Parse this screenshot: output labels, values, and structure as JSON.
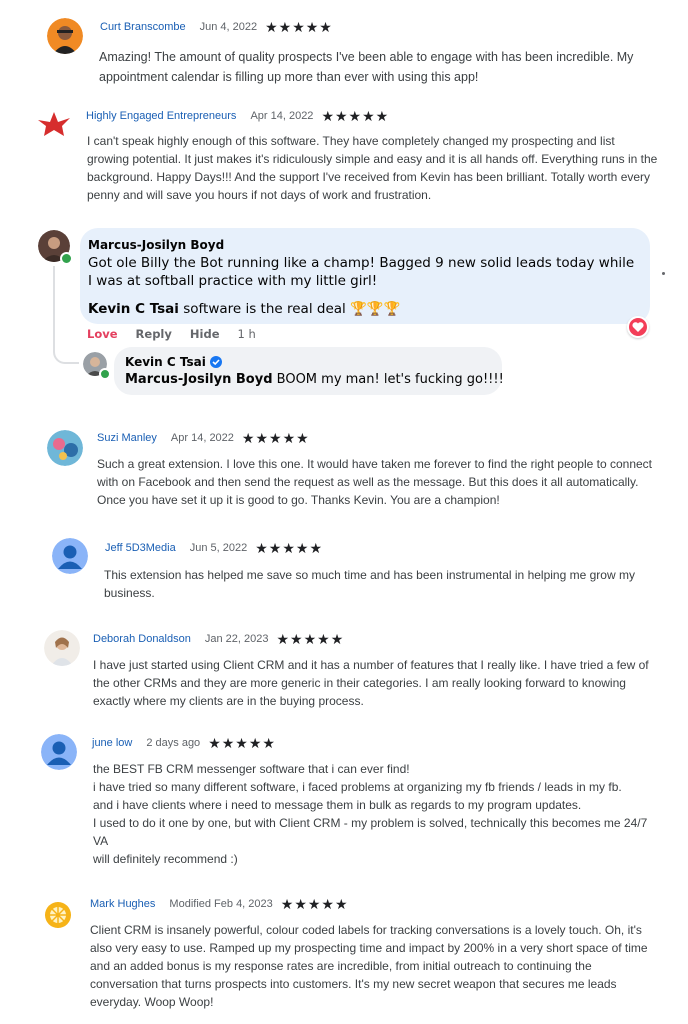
{
  "reviews": [
    {
      "name": "Curt Branscombe",
      "date": "Jun 4, 2022",
      "stars": "★★★★★",
      "text": "Amazing! The amount of quality prospects I've been able to engage with has been incredible. My\nappointment calendar is filling up more than ever with using this app!"
    },
    {
      "name": "Highly Engaged Entrepreneurs",
      "date": "Apr 14, 2022",
      "stars": "★★★★★",
      "text": "I can't speak highly enough of this software. They have completely changed my prospecting and list\ngrowing potential. It just makes it's ridiculously simple and easy and it is all hands off. Everything runs in the\nbackground. Happy Days!!! And the support I've received from Kevin has been brilliant. Totally worth every\npenny and will save you hours if not days of work and frustration."
    },
    {
      "name": "Suzi Manley",
      "date": "Apr 14, 2022",
      "stars": "★★★★★",
      "text": "Such a great extension. I love this one. It would have taken me forever to find the right people to connect\nwith on Facebook and then send the request as well as the message. But this does it all automatically.\nOnce you have set it up it is good to go. Thanks Kevin. You are a champion!"
    },
    {
      "name": "Jeff 5D3Media",
      "date": "Jun 5, 2022",
      "stars": "★★★★★",
      "text": "This extension has helped me save so much time and has been instrumental in helping me grow my\nbusiness."
    },
    {
      "name": "Deborah Donaldson",
      "date": "Jan 22, 2023",
      "stars": "★★★★★",
      "text": "I have just started using Client CRM and it has a number of features that I really like.  I have tried a few of\nthe other CRMs and they are more generic in their categories.  I am really looking forward to knowing\nexactly where my clients are in the buying process."
    },
    {
      "name": "june low",
      "date": "2 days ago",
      "stars": "★★★★★",
      "text": "the BEST FB CRM messenger software that i can ever find!\ni have tried so many different software, i faced problems at organizing my fb friends / leads in my fb.\nand i have clients where i need to message them in bulk as regards to my program updates.\nI used to do it one by one, but with Client CRM - my problem is solved, technically this becomes me 24/7\nVA\nwill definitely recommend :)"
    },
    {
      "name": "Mark Hughes",
      "date": "Modified Feb 4, 2023",
      "stars": "★★★★★",
      "text": "Client CRM is insanely powerful, colour coded labels for tracking conversations is a lovely touch. Oh, it's\nalso very easy to use. Ramped up my prospecting time and impact by 200% in a very short space of time\nand an added bonus is my response rates are incredible, from initial outreach to continuing the\nconversation that turns prospects into customers. It's my new secret weapon that secures me leads\neveryday. Woop Woop!"
    }
  ],
  "fb_comment": {
    "name": "Marcus-Josilyn Boyd",
    "text": "Got ole Billy the Bot running like a champ! Bagged 9 new solid leads today while I was at softball practice with my little girl!",
    "mention": "Kevin C Tsai",
    "mention_rest": " software is the real deal 🏆🏆🏆",
    "actions": {
      "love": "Love",
      "reply": "Reply",
      "hide": "Hide",
      "time": "1 h"
    },
    "reply": {
      "name": "Kevin C Tsai",
      "mention": "Marcus-Josilyn Boyd",
      "text": " BOOM my man! let's fucking go!!!!"
    }
  },
  "colors": {
    "name_link": "#1a5fb4",
    "love": "#e4405f",
    "bubble": "#e7f0fb",
    "reply_bubble": "#f0f2f5",
    "verified": "#1877f2"
  }
}
